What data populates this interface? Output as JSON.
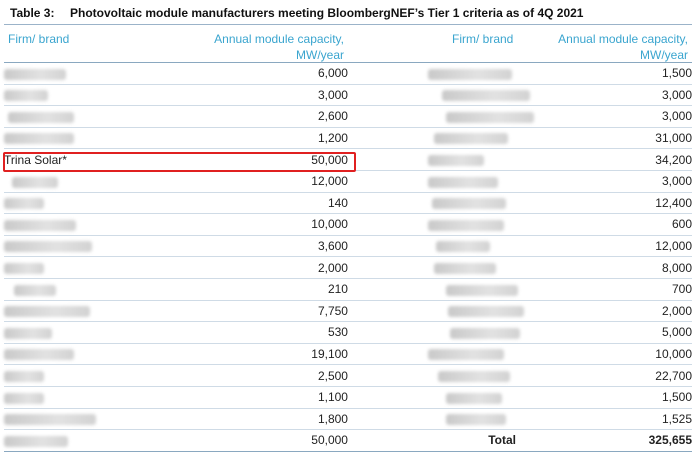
{
  "caption": {
    "number": "Table 3:",
    "title": "Photovoltaic module manufacturers meeting BloombergNEF’s Tier 1 criteria as of 4Q 2021"
  },
  "headers": {
    "firm_left": "Firm/ brand",
    "capacity_left_line1": "Annual module capacity,",
    "capacity_left_line2": "MW/year",
    "firm_right": "Firm/ brand",
    "capacity_right_line1": "Annual module capacity,",
    "capacity_right_line2": "MW/year"
  },
  "rows": [
    {
      "left_name": "",
      "left_capacity": "6,000",
      "right_name": "",
      "right_capacity": "1,500"
    },
    {
      "left_name": "",
      "left_capacity": "3,000",
      "right_name": "",
      "right_capacity": "3,000"
    },
    {
      "left_name": "",
      "left_capacity": "2,600",
      "right_name": "",
      "right_capacity": "3,000"
    },
    {
      "left_name": "",
      "left_capacity": "1,200",
      "right_name": "",
      "right_capacity": "31,000"
    },
    {
      "left_name": "Trina Solar*",
      "left_capacity": "50,000",
      "right_name": "",
      "right_capacity": "34,200"
    },
    {
      "left_name": "",
      "left_capacity": "12,000",
      "right_name": "",
      "right_capacity": "3,000"
    },
    {
      "left_name": "",
      "left_capacity": "140",
      "right_name": "",
      "right_capacity": "12,400"
    },
    {
      "left_name": "",
      "left_capacity": "10,000",
      "right_name": "",
      "right_capacity": "600"
    },
    {
      "left_name": "",
      "left_capacity": "3,600",
      "right_name": "",
      "right_capacity": "12,000"
    },
    {
      "left_name": "",
      "left_capacity": "2,000",
      "right_name": "",
      "right_capacity": "8,000"
    },
    {
      "left_name": "",
      "left_capacity": "210",
      "right_name": "",
      "right_capacity": "700"
    },
    {
      "left_name": "",
      "left_capacity": "7,750",
      "right_name": "",
      "right_capacity": "2,000"
    },
    {
      "left_name": "",
      "left_capacity": "530",
      "right_name": "",
      "right_capacity": "5,000"
    },
    {
      "left_name": "",
      "left_capacity": "19,100",
      "right_name": "",
      "right_capacity": "10,000"
    },
    {
      "left_name": "",
      "left_capacity": "2,500",
      "right_name": "",
      "right_capacity": "22,700"
    },
    {
      "left_name": "",
      "left_capacity": "1,100",
      "right_name": "",
      "right_capacity": "1,500"
    },
    {
      "left_name": "",
      "left_capacity": "1,800",
      "right_name": "",
      "right_capacity": "1,525"
    },
    {
      "left_name": "",
      "left_capacity": "50,000",
      "right_name": "Total",
      "right_capacity": "325,655"
    }
  ],
  "total_row_index": 17,
  "highlight_row_index": 4,
  "colors": {
    "header_text": "#3aa5cf",
    "highlight_border": "#e02020",
    "rule": "#8aa8c0"
  }
}
